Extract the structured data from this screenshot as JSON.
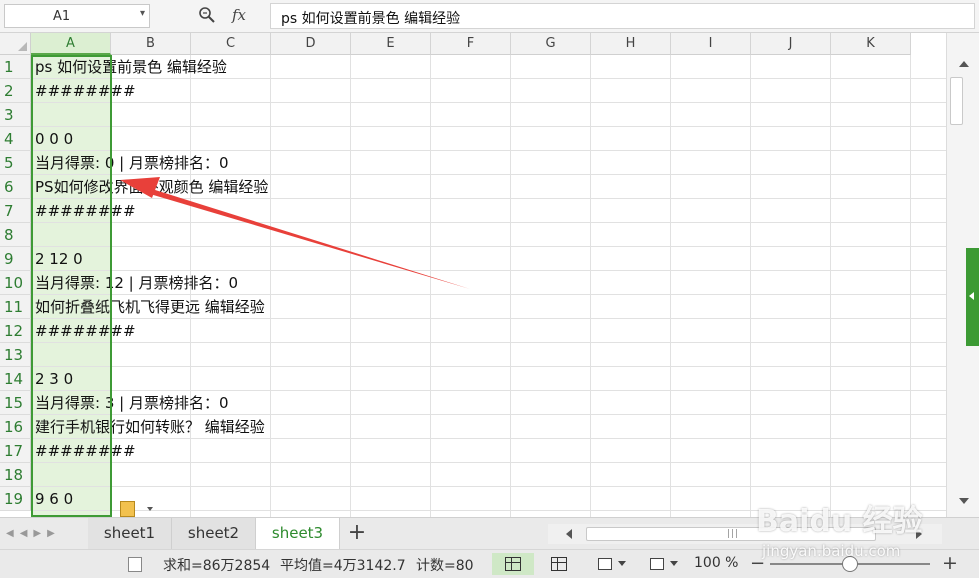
{
  "formula_bar": {
    "cell_ref": "A1",
    "fx_label": "fx",
    "formula": "ps 如何设置前景色 编辑经验"
  },
  "columns": [
    "A",
    "B",
    "C",
    "D",
    "E",
    "F",
    "G",
    "H",
    "I",
    "J",
    "K"
  ],
  "selected_column": "A",
  "rows": [
    "1",
    "2",
    "3",
    "4",
    "5",
    "6",
    "7",
    "8",
    "9",
    "10",
    "11",
    "12",
    "13",
    "14",
    "15",
    "16",
    "17",
    "18",
    "19"
  ],
  "cells": [
    "ps 如何设置前景色 编辑经验",
    "########",
    "",
    "0 0 0",
    "当月得票: 0 | 月票榜排名：0",
    "PS如何修改界面外观颜色 编辑经验",
    "########",
    "",
    "2 12 0",
    "当月得票: 12 | 月票榜排名：0",
    "如何折叠纸飞机飞得更远 编辑经验",
    "########",
    "",
    "2 3 0",
    "当月得票: 3 | 月票榜排名：0",
    "建行手机银行如何转账？ 编辑经验",
    "########",
    "",
    "9 6 0"
  ],
  "sheets": {
    "tabs": [
      "sheet1",
      "sheet2",
      "sheet3"
    ],
    "active": "sheet3",
    "add_label": "+"
  },
  "status": {
    "sum": "求和=86万2854",
    "average": "平均值=4万3142.7",
    "count": "计数=80",
    "zoom": "100 %",
    "zoom_minus": "−",
    "zoom_plus": "+"
  },
  "watermark": {
    "logo": "Baidu 经验",
    "url": "jingyan.baidu.com"
  },
  "colors": {
    "selection": "#3e9a35",
    "selected_col_bg": "#e4f3dc",
    "arrow": "#e8403a",
    "active_tab_text": "#2e8b2e"
  },
  "icons": [
    "zoom-icon",
    "fx-icon",
    "dropdown-icon",
    "paste-options-icon",
    "document-icon",
    "normal-view-icon",
    "page-break-view-icon",
    "page-layout-icon",
    "reading-mode-icon"
  ]
}
